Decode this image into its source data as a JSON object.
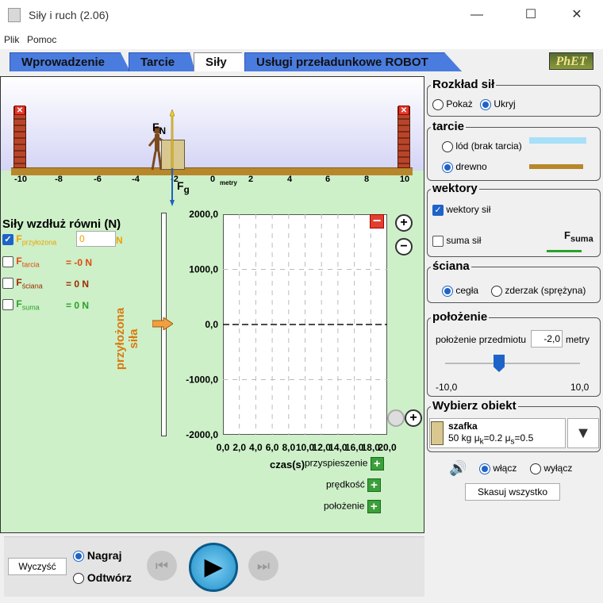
{
  "window": {
    "title": "Siły i ruch (2.06)",
    "minimize": "—",
    "maximize": "☐",
    "close": "✕"
  },
  "menu": {
    "items": [
      "Plik",
      "Pomoc"
    ]
  },
  "tabs": [
    {
      "label": "Wprowadzenie"
    },
    {
      "label": "Tarcie"
    },
    {
      "label": "Siły"
    },
    {
      "label": "Usługi przeładunkowe ROBOT"
    }
  ],
  "logo": "PhET",
  "scene": {
    "ticks": [
      "-10",
      "-8",
      "-6",
      "-4",
      "-2",
      "0",
      "2",
      "4",
      "6",
      "8",
      "10"
    ],
    "metry": "metry",
    "fn_label": "F",
    "fn_sub": "N",
    "fg_label": "F",
    "fg_sub": "g",
    "wall_close": "✕"
  },
  "forces": {
    "title": "Siły wzdłuż równi (N)",
    "rows": [
      {
        "name": "F",
        "sub": "przyłożona",
        "value": "0",
        "unit": "N",
        "checked": true,
        "color": "#f0a000"
      },
      {
        "name": "F",
        "sub": "tarcia",
        "value": "= -0 N",
        "checked": false,
        "color": "#e04a10"
      },
      {
        "name": "F",
        "sub": "ściana",
        "value": "= 0 N",
        "checked": false,
        "color": "#a02a00"
      },
      {
        "name": "F",
        "sub": "suma",
        "value": "= 0 N",
        "checked": false,
        "color": "#2aa02a"
      }
    ]
  },
  "slider_label": "przyłożona siła",
  "chart_data": {
    "type": "line",
    "title": "",
    "xlabel": "czas(s)",
    "ylabel": "",
    "xlim": [
      0,
      20
    ],
    "ylim": [
      -2000,
      2000
    ],
    "yticks": [
      "2000,0",
      "1000,0",
      "0,0",
      "-1000,0",
      "-2000,0"
    ],
    "xticks": [
      "0,0",
      "2,0",
      "4,0",
      "6,0",
      "8,0",
      "10,0",
      "12,0",
      "14,0",
      "16,0",
      "18,0",
      "20,0"
    ],
    "series": [
      {
        "x": [
          0,
          20
        ],
        "values": [
          0,
          0
        ]
      }
    ]
  },
  "graph_buttons": {
    "acceleration": "przyspieszenie",
    "velocity": "prędkość",
    "position": "położenie"
  },
  "playback": {
    "clear": "Wyczyść",
    "record": "Nagraj",
    "playback": "Odtwórz",
    "record_selected": true
  },
  "panels": {
    "distribution": {
      "title": "Rozkład sił",
      "show": "Pokaż",
      "hide": "Ukryj",
      "selected": "hide"
    },
    "friction": {
      "title": "tarcie",
      "ice": "lód (brak tarcia)",
      "wood": "drewno",
      "selected": "wood"
    },
    "vectors": {
      "title": "wektory",
      "force_vectors": "wektory sił",
      "force_vectors_checked": true,
      "sum": "suma sił",
      "sum_checked": false,
      "sum_label": "F",
      "sum_sub": "suma"
    },
    "wall": {
      "title": "ściana",
      "brick": "cegła",
      "bumper": "zderzak (sprężyna)",
      "selected": "brick"
    },
    "position": {
      "title": "położenie",
      "label": "położenie przedmiotu",
      "value": "-2,0",
      "unit": "metry",
      "min": "-10,0",
      "max": "10,0",
      "current": -2
    },
    "object": {
      "title": "Wybierz obiekt",
      "name": "szafka",
      "desc": "50 kg μ",
      "desc_k": "k",
      "desc_mid": "=0.2 μ",
      "desc_s": "s",
      "desc_end": "=0.5"
    }
  },
  "sound": {
    "on": "włącz",
    "off": "wyłącz",
    "selected": "on"
  },
  "reset": "Skasuj wszystko"
}
